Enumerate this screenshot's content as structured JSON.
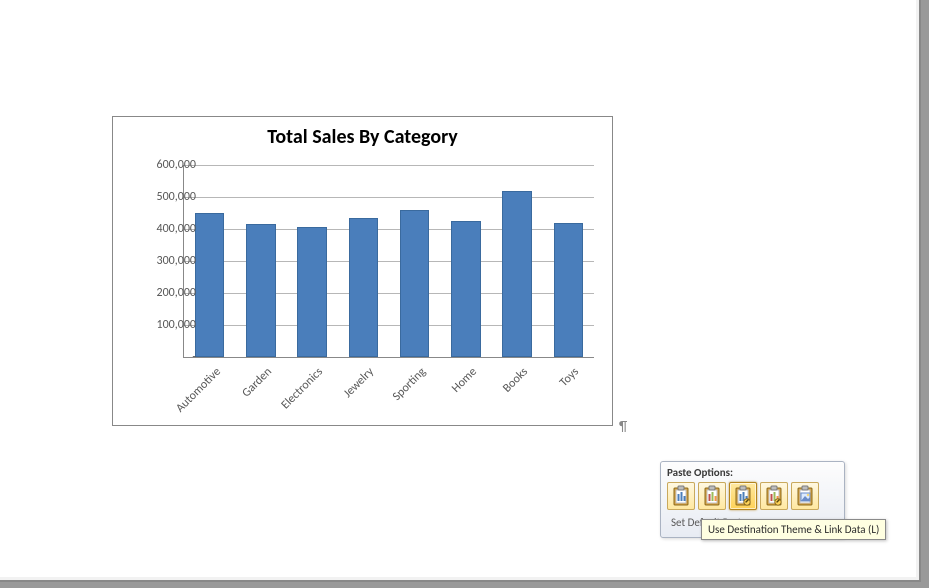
{
  "chart_data": {
    "type": "bar",
    "title": "Total Sales By Category",
    "xlabel": "",
    "ylabel": "",
    "ylim": [
      0,
      600000
    ],
    "y_ticks": [
      0,
      100000,
      200000,
      300000,
      400000,
      500000,
      600000
    ],
    "y_tick_labels": [
      "-",
      "100,000",
      "200,000",
      "300,000",
      "400,000",
      "500,000",
      "600,000"
    ],
    "categories": [
      "Automotive",
      "Garden",
      "Electronics",
      "Jewelry",
      "Sporting",
      "Home",
      "Books",
      "Toys"
    ],
    "values": [
      450000,
      415000,
      405000,
      435000,
      460000,
      425000,
      520000,
      420000
    ]
  },
  "paragraph_mark": "¶",
  "paste_options": {
    "title": "Paste Options:",
    "buttons": [
      {
        "name": "use-dest-theme-chart",
        "selected": false
      },
      {
        "name": "keep-source-formatting",
        "selected": false
      },
      {
        "name": "use-dest-theme-link-data",
        "selected": true
      },
      {
        "name": "keep-source-link-data",
        "selected": false
      },
      {
        "name": "picture",
        "selected": false
      }
    ],
    "set_default_label": "Set Default Paste",
    "tooltip": "Use Destination Theme & Link Data (L)"
  }
}
